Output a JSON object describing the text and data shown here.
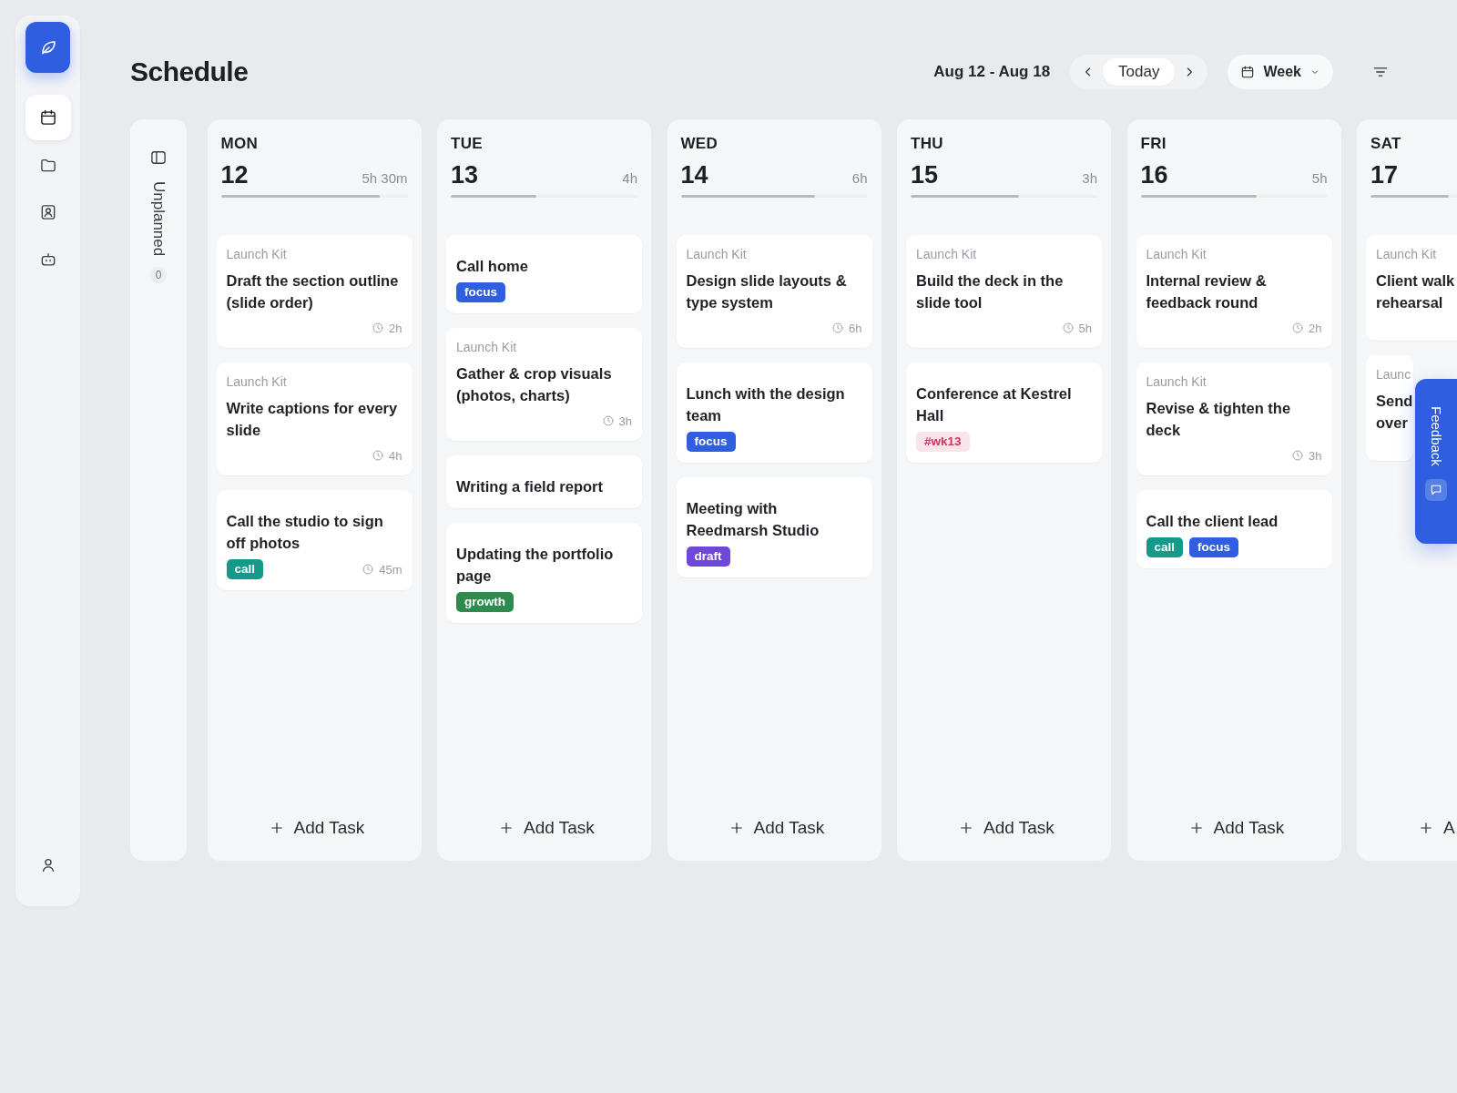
{
  "sidebar": {
    "items": [
      {
        "kind": "calendar",
        "selected": true
      },
      {
        "kind": "folder",
        "selected": false
      },
      {
        "kind": "contact",
        "selected": false
      },
      {
        "kind": "bot",
        "selected": false
      }
    ]
  },
  "header": {
    "title": "Schedule",
    "date_range": "Aug 12 - Aug 18",
    "today": "Today",
    "view": "Week"
  },
  "unplanned": {
    "label": "Unplanned",
    "count": "0"
  },
  "days": [
    {
      "name": "MON",
      "date": "12",
      "hours": "5h 30m",
      "level": 0.85,
      "add_label": "Add Task",
      "tasks": [
        {
          "project": "Launch Kit",
          "title": "Draft the section outline (slide order)",
          "duration": "2h"
        },
        {
          "project": "Launch Kit",
          "title": "Write captions for every slide",
          "duration": "4h"
        },
        {
          "title": "Call the studio to sign off photos",
          "tags": [
            {
              "label": "call",
              "color": "#14998a",
              "kind": "solid"
            }
          ],
          "duration": "45m"
        }
      ]
    },
    {
      "name": "TUE",
      "date": "13",
      "hours": "4h",
      "level": 0.46,
      "add_label": "Add Task",
      "tasks": [
        {
          "title": "Call home",
          "tags": [
            {
              "label": "focus",
              "color": "#2f5fe0",
              "kind": "solid"
            }
          ]
        },
        {
          "project": "Launch Kit",
          "title": "Gather & crop visuals (photos, charts)",
          "duration": "3h"
        },
        {
          "title": "Writing a field report"
        },
        {
          "title": "Updating the portfolio page",
          "tags": [
            {
              "label": "growth",
              "color": "#2e8b4e",
              "kind": "solid"
            }
          ]
        }
      ]
    },
    {
      "name": "WED",
      "date": "14",
      "hours": "6h",
      "level": 0.72,
      "add_label": "Add Task",
      "tasks": [
        {
          "project": "Launch Kit",
          "title": "Design slide layouts & type system",
          "duration": "6h"
        },
        {
          "title": "Lunch with the design team",
          "tags": [
            {
              "label": "focus",
              "color": "#2f5fe0",
              "kind": "solid"
            }
          ]
        },
        {
          "title": "Meeting with Reedmarsh Studio",
          "tags": [
            {
              "label": "draft",
              "color": "#7048d8",
              "kind": "solid"
            }
          ]
        }
      ]
    },
    {
      "name": "THU",
      "date": "15",
      "hours": "3h",
      "level": 0.58,
      "add_label": "Add Task",
      "tasks": [
        {
          "project": "Launch Kit",
          "title": "Build the deck in the slide tool",
          "duration": "5h"
        },
        {
          "title": "Conference at Kestrel Hall",
          "tags": [
            {
              "label": "#wk13",
              "color": "#c8385e",
              "kind": "soft"
            }
          ]
        }
      ]
    },
    {
      "name": "FRI",
      "date": "16",
      "hours": "5h",
      "level": 0.62,
      "add_label": "Add Task",
      "tasks": [
        {
          "project": "Launch Kit",
          "title": "Internal review & feedback round",
          "duration": "2h"
        },
        {
          "project": "Launch Kit",
          "title": "Revise & tighten the deck",
          "duration": "3h"
        },
        {
          "title": "Call the client lead",
          "tags": [
            {
              "label": "call",
              "color": "#14998a",
              "kind": "solid"
            },
            {
              "label": "focus",
              "color": "#2f5fe0",
              "kind": "solid"
            }
          ]
        }
      ]
    },
    {
      "name": "SAT",
      "date": "17",
      "level": 0.42,
      "add_label": "A",
      "tasks": [
        {
          "project": "Launch Kit",
          "title": "Client walk\nrehearsal"
        },
        {
          "project": "Launc",
          "title": "Send\nover"
        }
      ]
    }
  ],
  "feedback": {
    "label": "Feedback"
  }
}
